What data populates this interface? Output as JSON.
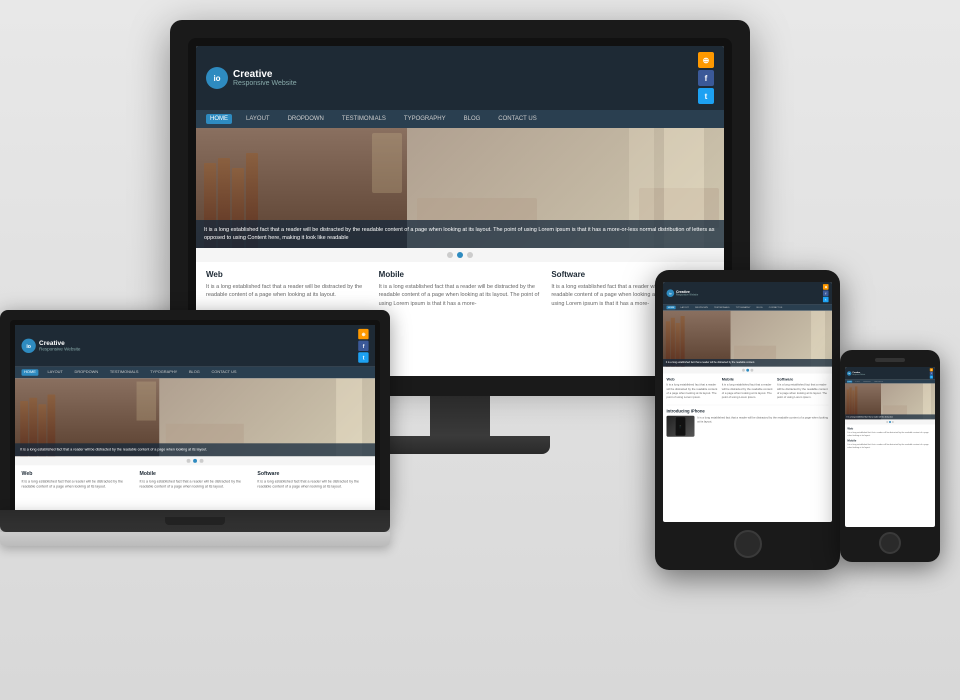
{
  "site": {
    "title": "Creative",
    "subtitle": "Responsive Website",
    "logo_letter": "io",
    "nav": [
      "HOME",
      "LAYOUT",
      "DROPDOWN",
      "TESTIMONIALS",
      "TYPOGRAPHY",
      "BLOG",
      "CONTACT US"
    ],
    "active_nav": 0,
    "hero_text": "It is a long established fact that a reader will be distracted by the readable content of a page when looking at its layout. The point of using Lorem ipsum is that it has a more-or-less normal distribution of letters as opposed to using Content here, making it look like readable",
    "sections": [
      {
        "title": "Web",
        "text": "It is a long established fact that a reader will be distracted by the readable content of a page when looking at its layout."
      },
      {
        "title": "Mobile",
        "text": "It is a long established fact that a reader will be distracted by the readable content of a page when looking at its layout. The point of using Lorem ipsum is that it has a more-"
      },
      {
        "title": "Software",
        "text": "It is a long established fact that a reader will be distracted by the readable content of a page when looking at its layout. The point of using Lorem ipsum is that it has a more-"
      }
    ]
  },
  "devices": {
    "monitor_label": "desktop monitor",
    "laptop_label": "laptop computer",
    "tablet_label": "tablet device",
    "phone_label": "smartphone"
  }
}
